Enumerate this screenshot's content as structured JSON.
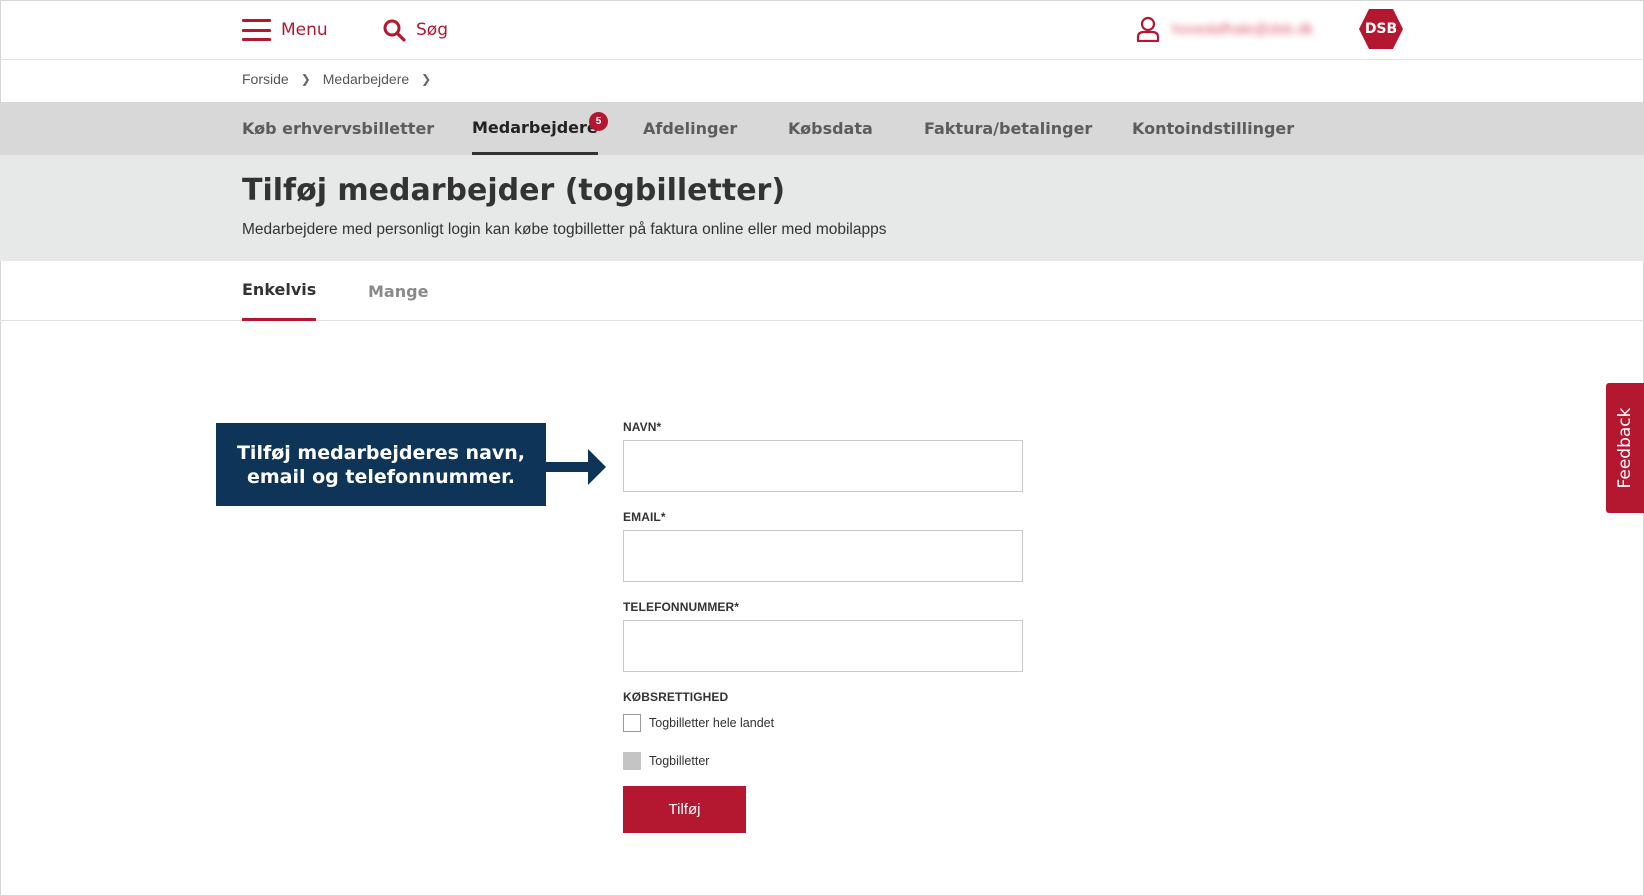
{
  "topbar": {
    "menu_label": "Menu",
    "search_label": "Søg",
    "user_email": "hovedafhale@dsb.dk",
    "logo_text": "DSB"
  },
  "breadcrumb": [
    "Forside",
    "Medarbejdere"
  ],
  "nav": {
    "items": [
      {
        "label": "Køb erhvervsbilletter"
      },
      {
        "label": "Medarbejdere",
        "badge": "5",
        "active": true
      },
      {
        "label": "Afdelinger"
      },
      {
        "label": "Købsdata"
      },
      {
        "label": "Faktura/betalinger"
      },
      {
        "label": "Kontoindstillinger"
      }
    ]
  },
  "header": {
    "title": "Tilføj medarbejder (togbilletter)",
    "subtitle": "Medarbejdere med personligt login kan købe togbilletter på faktura online eller med mobilapps"
  },
  "subtabs": [
    {
      "label": "Enkelvis",
      "active": true
    },
    {
      "label": "Mange"
    }
  ],
  "callout": {
    "line1": "Tilføj medarbejderes navn,",
    "line2": "email og telefonnummer."
  },
  "form": {
    "name_label": "NAVN*",
    "name_value": "",
    "email_label": "EMAIL*",
    "email_value": "",
    "phone_label": "TELEFONNUMMER*",
    "phone_value": "",
    "rights_label": "KØBSRETTIGHED",
    "checkbox1_label": "Togbilletter hele landet",
    "checkbox1_checked": false,
    "checkbox2_label": "Togbilletter",
    "checkbox2_disabled": true,
    "submit_label": "Tilføj"
  },
  "feedback_label": "Feedback",
  "colors": {
    "brand_red": "#b41730",
    "callout_navy": "#0e3457",
    "nav_gray": "#d8d8d8",
    "header_band": "#e6e9e8"
  }
}
